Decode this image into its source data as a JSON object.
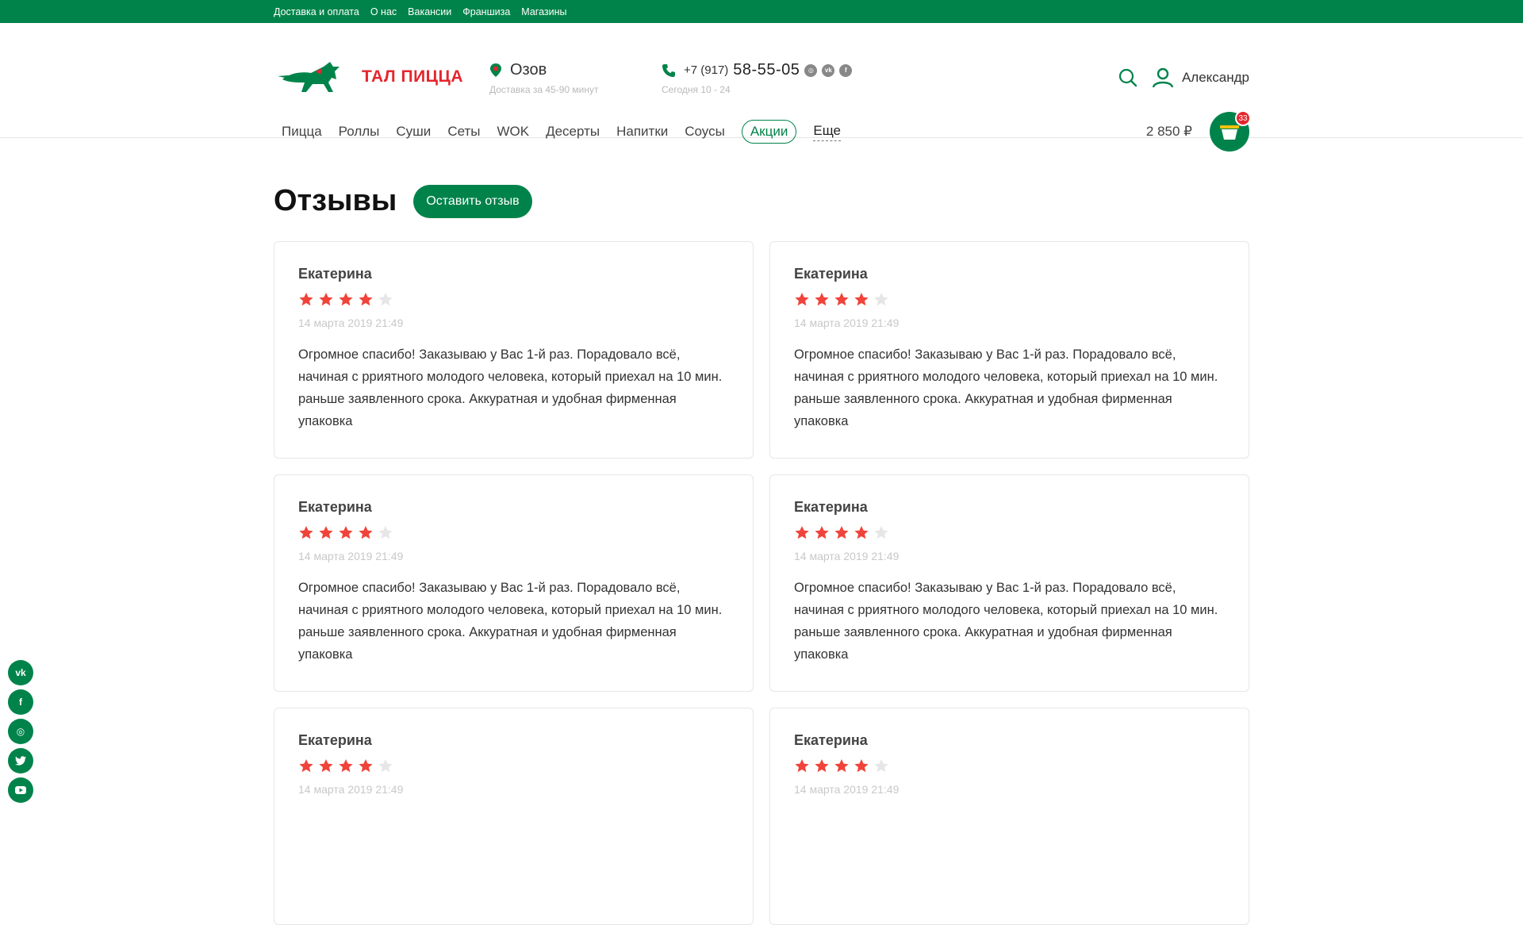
{
  "topbar": {
    "links": [
      "Доставка и оплата",
      "О нас",
      "Вакансии",
      "Франшиза",
      "Магазины"
    ]
  },
  "header": {
    "logo_text": "ТАЛ ПИЦЦА",
    "city": "Озов",
    "delivery_time": "Доставка за 45-90 минут",
    "phone_prefix": "+7 (917)",
    "phone_number": "58-55-05",
    "hours": "Сегодня 10 - 24",
    "user_name": "Александр"
  },
  "nav": {
    "items": [
      "Пицца",
      "Роллы",
      "Суши",
      "Сеты",
      "WOK",
      "Десерты",
      "Напитки",
      "Соусы"
    ],
    "promo": "Акции",
    "more": "Еще"
  },
  "cart": {
    "sum": "2 850 ₽",
    "count": "33"
  },
  "page": {
    "title": "Отзывы",
    "leave_review": "Оставить отзыв"
  },
  "reviews": [
    {
      "name": "Екатерина",
      "rating": 4,
      "date": "14 марта 2019 21:49",
      "text": "Огромное спасибо! Заказываю у Вас 1-й раз. Порадовало всё, начиная с рриятного молодого человека, который приехал на 10 мин. раньше заявленного срока. Аккуратная и удобная фирменная упаковка"
    },
    {
      "name": "Екатерина",
      "rating": 4,
      "date": "14 марта 2019 21:49",
      "text": "Огромное спасибо! Заказываю у Вас 1-й раз. Порадовало всё, начиная с рриятного молодого человека, который приехал на 10 мин. раньше заявленного срока. Аккуратная и удобная фирменная упаковка"
    },
    {
      "name": "Екатерина",
      "rating": 4,
      "date": "14 марта 2019 21:49",
      "text": "Огромное спасибо! Заказываю у Вас 1-й раз. Порадовало всё, начиная с рриятного молодого человека, который приехал на 10 мин. раньше заявленного срока. Аккуратная и удобная фирменная упаковка"
    },
    {
      "name": "Екатерина",
      "rating": 4,
      "date": "14 марта 2019 21:49",
      "text": "Огромное спасибо! Заказываю у Вас 1-й раз. Порадовало всё, начиная с рриятного молодого человека, который приехал на 10 мин. раньше заявленного срока. Аккуратная и удобная фирменная упаковка"
    },
    {
      "name": "Екатерина",
      "rating": 4,
      "date": "14 марта 2019 21:49",
      "text": ""
    },
    {
      "name": "Екатерина",
      "rating": 4,
      "date": "14 марта 2019 21:49",
      "text": ""
    }
  ],
  "side_social": [
    "vk-icon",
    "facebook-icon",
    "instagram-icon",
    "twitter-icon",
    "youtube-icon"
  ],
  "colors": {
    "brand_green": "#00834a",
    "brand_red": "#e5262d",
    "star": "#f0433a",
    "star_empty": "#e6e6e6"
  }
}
